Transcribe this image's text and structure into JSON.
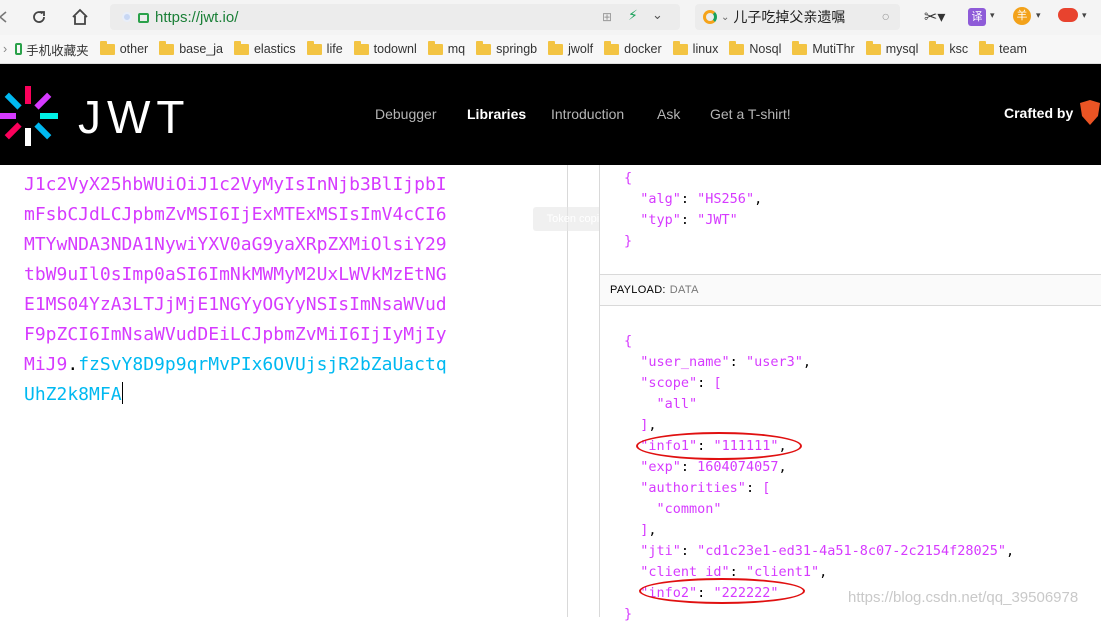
{
  "browser": {
    "url": "https://jwt.io/",
    "search_text": "儿子吃掉父亲遗嘱"
  },
  "bookmarks": {
    "mobile": "手机收藏夹",
    "items": [
      "other",
      "base_ja",
      "elastics",
      "life",
      "todownl",
      "mq",
      "springb",
      "jwolf",
      "docker",
      "linux",
      "Nosql",
      "MutiThr",
      "mysql",
      "ksc",
      "team"
    ]
  },
  "header": {
    "logo": "JWT",
    "nav": [
      "Debugger",
      "Libraries",
      "Introduction",
      "Ask",
      "Get a T-shirt!"
    ],
    "active": "Libraries",
    "crafted": "Crafted by"
  },
  "token": {
    "payload_lines": [
      "J1c2VyX25hbWUiOiJ1c2VyMyIsInNjb3BlIjpbI",
      "mFsbCJdLCJpbmZvMSI6IjExMTExMSIsImV4cCI6",
      "MTYwNDA3NDA1NywiYXV0aG9yaXRpZXMiOlsiY29",
      "tbW9uIl0sImp0aSI6ImNkMWMyM2UxLWVkMzEtNG",
      "E1MS04YzA3LTJjMjE1NGYyOGYyNSIsImNsaWVud",
      "F9pZCI6ImNsaWVudDEiLCJpbmZvMiI6IjIyMjIy",
      "MiJ9"
    ],
    "dot": ".",
    "signature_part1": "fzSvY8D9p9qrMvPIx6OVUjsjR2bZaUactq",
    "signature_part2": "UhZ2k8MFA"
  },
  "tooltip": "Token copied",
  "header_json": {
    "open": "{",
    "alg_key": "\"alg\"",
    "alg_val": "\"HS256\"",
    "typ_key": "\"typ\"",
    "typ_val": "\"JWT\"",
    "close": "}"
  },
  "payload_section": {
    "label": "PAYLOAD:",
    "sub": "DATA"
  },
  "payload_json": {
    "open": "{",
    "user_name_key": "\"user_name\"",
    "user_name_val": "\"user3\"",
    "scope_key": "\"scope\"",
    "scope_item": "\"all\"",
    "info1_key": "\"info1\"",
    "info1_val": "\"111111\"",
    "exp_key": "\"exp\"",
    "exp_val": "1604074057",
    "authorities_key": "\"authorities\"",
    "authorities_item": "\"common\"",
    "jti_key": "\"jti\"",
    "jti_val": "\"cd1c23e1-ed31-4a51-8c07-2c2154f28025\"",
    "client_id_key": "\"client_id\"",
    "client_id_val": "\"client1\"",
    "info2_key": "\"info2\"",
    "info2_val": "\"222222\"",
    "close": "}"
  },
  "watermark": "https://blog.csdn.net/qq_39506978",
  "colors": {
    "payload": "#d63aff",
    "signature": "#00b9f1",
    "annotation": "#e01010"
  }
}
